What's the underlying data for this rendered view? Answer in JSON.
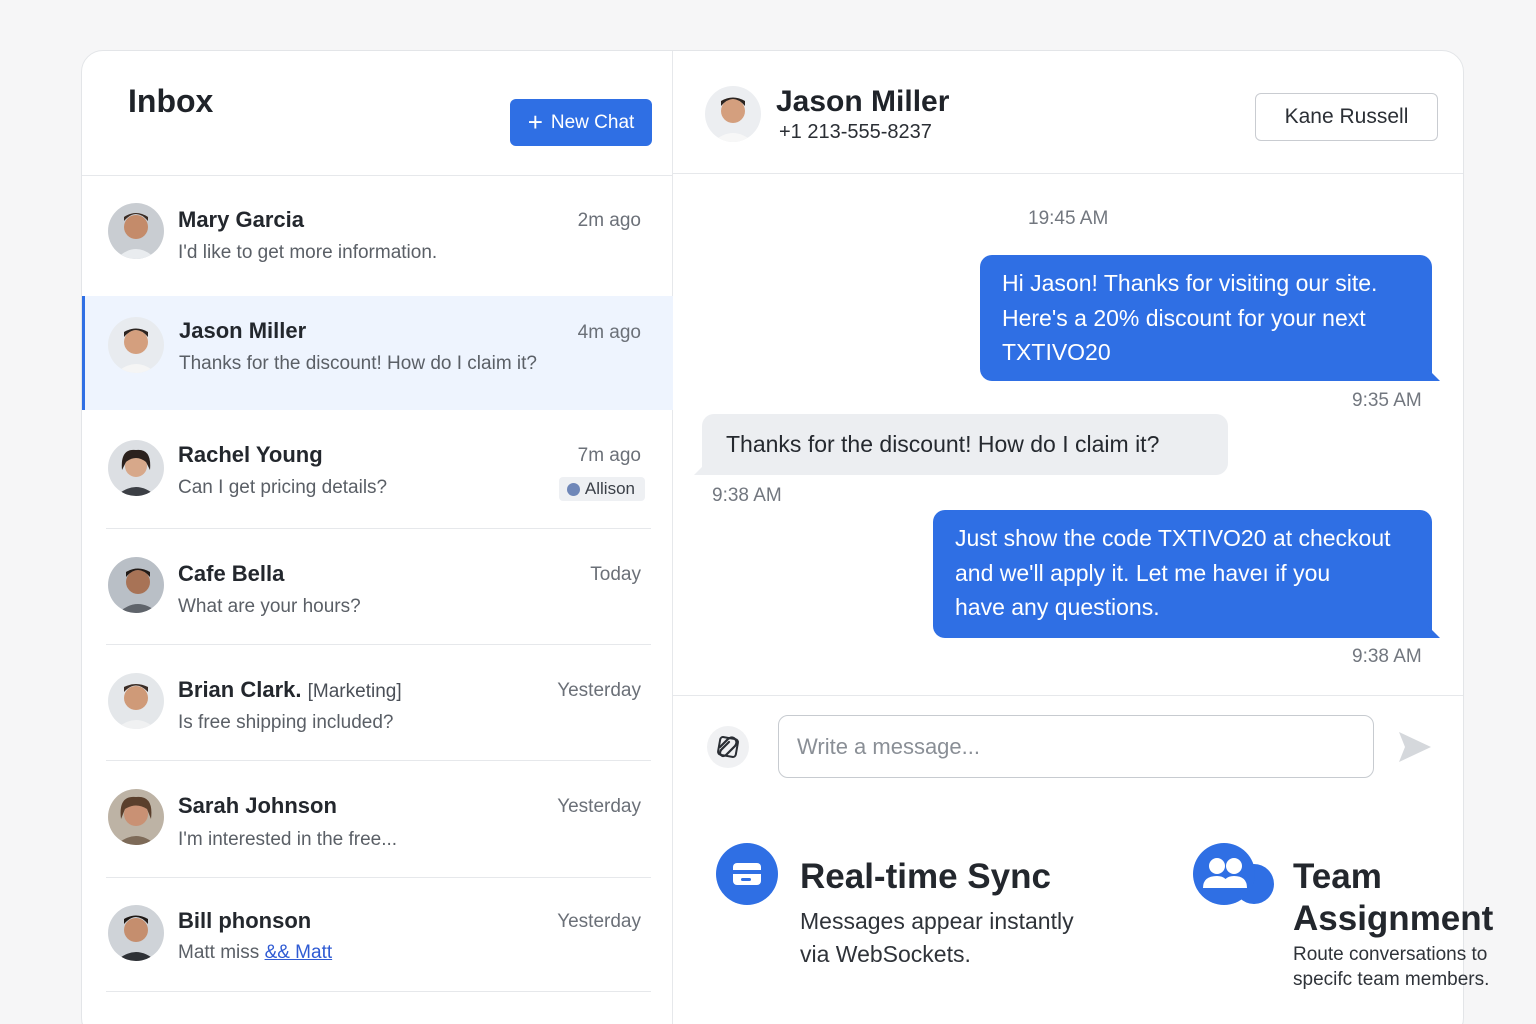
{
  "inbox": {
    "title": "Inbox",
    "new_chat_label": "New Chat"
  },
  "conversations": [
    {
      "name": "Mary Garcia",
      "time": "2m ago",
      "preview": "I'd like to get more information."
    },
    {
      "name": "Jason Miller",
      "time": "4m ago",
      "preview": "Thanks for the discount! How do I claim it?"
    },
    {
      "name": "Rachel Young",
      "time": "7m ago",
      "preview": "Can I get pricing details?",
      "assignee": "Allison"
    },
    {
      "name": "Cafe Bella",
      "time": "Today",
      "preview": "What are your hours?"
    },
    {
      "name": "Brian Clark.",
      "tag": "[Marketing]",
      "time": "Yesterday",
      "preview": "Is free shipping included?"
    },
    {
      "name": "Sarah Johnson",
      "time": "Yesterday",
      "preview": "I'm interested in the free..."
    },
    {
      "name": "Bill phonson",
      "time": "Yesterday",
      "preview": "Matt miss",
      "preview_link": "&& Matt"
    }
  ],
  "chat": {
    "contact_name": "Jason Miller",
    "contact_phone": "+1 213-555-8237",
    "assigned_agent": "Kane Russell",
    "top_timestamp": "19:45 AM",
    "messages": [
      {
        "direction": "out",
        "lines": [
          "Hi Jason! Thanks for visiting our site.",
          "Here's a 20% discount for your next",
          "TXTIVO20"
        ],
        "time": "9:35 AM"
      },
      {
        "direction": "in",
        "lines": [
          "Thanks for the discount! How do I claim it?"
        ],
        "time": "9:38 AM"
      },
      {
        "direction": "out",
        "lines": [
          "Just show the code TXTIVO20 at checkout",
          "and we'll apply it. Let me haveı if you",
          "have any questions."
        ],
        "time": "9:38 AM"
      }
    ],
    "composer_placeholder": "Write a message..."
  },
  "features": [
    {
      "title": "Real-time Sync",
      "desc_lines": [
        "Messages appear instantly",
        "via WebSockets."
      ]
    },
    {
      "title_lines": [
        "Team",
        "Assignment"
      ],
      "desc_lines": [
        "Route conversations to",
        "specifc team members."
      ]
    }
  ],
  "colors": {
    "accent": "#2f6fe4",
    "active_row": "#eef4fe",
    "incoming_bubble": "#eceef1",
    "background": "#f6f6f7"
  },
  "icons": {
    "new_chat": "plus-icon",
    "attach": "paperclip-icon",
    "send": "send-arrow-icon",
    "sync": "message-card-icon",
    "team": "users-icon"
  }
}
